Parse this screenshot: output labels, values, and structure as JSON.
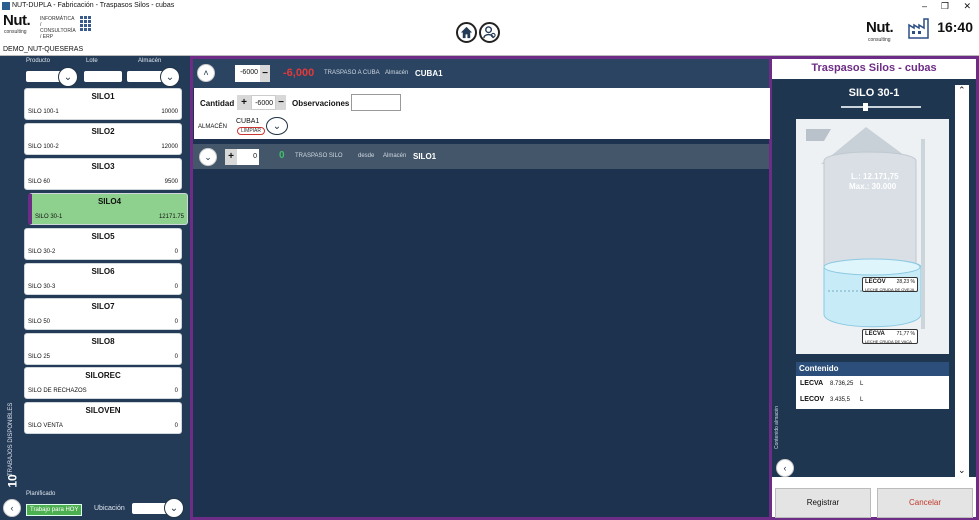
{
  "window": {
    "title": "NUT-DUPLA - Fabricación - Traspasos Silos - cubas"
  },
  "header": {
    "logo_text": "Nut.",
    "logo_sub": "consulting",
    "logo_tagline": "INFORMÁTICA / CONSULTORÍA / ERP",
    "clock": "16:40",
    "user": "DEMO_NUT-QUESERAS"
  },
  "left": {
    "filters": {
      "producto": "Producto",
      "lote": "Lote",
      "almacen": "Almacén"
    },
    "silos": [
      {
        "name": "SILO1",
        "sub": "SILO 100-1",
        "value": "10000"
      },
      {
        "name": "SILO2",
        "sub": "SILO 100-2",
        "value": "12000"
      },
      {
        "name": "SILO3",
        "sub": "SILO 60",
        "value": "9500"
      },
      {
        "name": "SILO4",
        "sub": "SILO 30-1",
        "value": "12171.75"
      },
      {
        "name": "SILO5",
        "sub": "SILO 30-2",
        "value": "0"
      },
      {
        "name": "SILO6",
        "sub": "SILO 30-3",
        "value": "0"
      },
      {
        "name": "SILO7",
        "sub": "SILO 50",
        "value": "0"
      },
      {
        "name": "SILO8",
        "sub": "SILO 25",
        "value": "0"
      },
      {
        "name": "SILOREC",
        "sub": "SILO DE RECHAZOS",
        "value": "0"
      },
      {
        "name": "SILOVEN",
        "sub": "SILO VENTA",
        "value": "0"
      }
    ],
    "count": "10",
    "count_label": "TRABAJOS DISPONIBLES",
    "planificado_label": "Planificado",
    "today_badge": "Trabajo para HOY",
    "ubicacion_label": "Ubicación"
  },
  "center": {
    "row1": {
      "qty": "-6000",
      "minus": "−",
      "amount": "-6,000",
      "label": "TRASPASO A CUBA",
      "almacen_label": "Almacén",
      "almacen": "CUBA1"
    },
    "panel": {
      "cantidad_label": "Cantidad",
      "plus": "+",
      "qty": "-6000",
      "minus": "−",
      "obs_label": "Observaciones",
      "almacen_label": "ALMACÉN",
      "cuba": "CUBA1",
      "limpiar": "LIMPIAR"
    },
    "row2": {
      "plus": "+",
      "qty": "0",
      "amount": "0",
      "label": "TRASPASO SILO",
      "desde": "desde",
      "almacen_label": "Almacén",
      "almacen": "SILO1"
    }
  },
  "right": {
    "title": "Traspasos Silos - cubas",
    "silo_name": "SILO 30-1",
    "capacity_l": "L.: 12.171,75",
    "capacity_max": "Max.: 30.000",
    "tag1": {
      "name": "LECOV",
      "pct": "28,23 %",
      "desc": "LECHE CRUDA DE OVEJA"
    },
    "tag2": {
      "name": "LECVA",
      "pct": "71,77 %",
      "desc": "LECHE CRUDA DE VACA"
    },
    "contenido_title": "Contenido",
    "contenido": [
      {
        "name": "LECVA",
        "value": "8.736,25",
        "unit": "L"
      },
      {
        "name": "LECOV",
        "value": "3.435,5",
        "unit": "L"
      }
    ],
    "side_label": "Contenido almacén",
    "registrar": "Registrar",
    "cancelar": "Cancelar"
  },
  "colors": {
    "accent": "#6d2d86",
    "panel_dark": "#1c324e",
    "selected": "#8ed18e",
    "amount_red": "#e23a3a",
    "amount_green": "#3fbf6a"
  }
}
